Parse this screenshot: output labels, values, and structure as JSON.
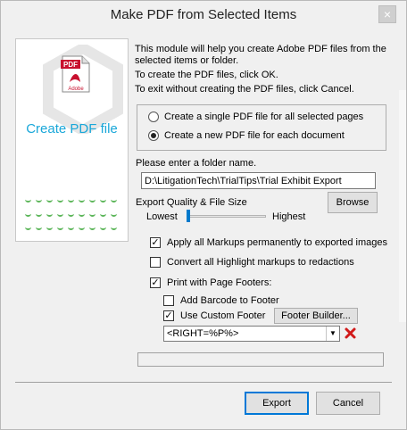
{
  "window": {
    "title": "Make PDF from Selected Items",
    "close_glyph": "×"
  },
  "banner": {
    "icon": "adobe-pdf-file-icon",
    "icon_badge": "PDF",
    "icon_brand": "Adobe",
    "title": "Create PDF file"
  },
  "intro": {
    "line1": "This module will help you create Adobe PDF files from the selected items or folder.",
    "line2": "To create the PDF files, click OK.",
    "line3": "To exit without creating the PDF files, click Cancel."
  },
  "mode": {
    "options": [
      {
        "label": "Create a single PDF file for all selected pages",
        "selected": false
      },
      {
        "label": "Create a new PDF file for each document",
        "selected": true
      }
    ]
  },
  "folder": {
    "label": "Please enter a folder name.",
    "value": "D:\\LitigationTech\\TrialTips\\Trial Exhibit Export",
    "browse_label": "Browse"
  },
  "quality": {
    "label": "Export Quality & File Size",
    "min_label": "Lowest",
    "max_label": "Highest",
    "level_fraction": 0.0
  },
  "options": {
    "apply_markups": {
      "label": "Apply all Markups permanently to exported images",
      "checked": true
    },
    "convert_highlight": {
      "label": "Convert all Highlight markups to redactions",
      "checked": false
    },
    "page_footers": {
      "label": "Print with Page Footers:",
      "checked": true
    },
    "add_barcode": {
      "label": "Add Barcode to Footer",
      "checked": false
    },
    "custom_footer": {
      "label": "Use Custom Footer",
      "checked": true
    },
    "footer_builder_label": "Footer Builder...",
    "footer_value": "<RIGHT=%P%>",
    "check_glyph": "✓",
    "dropdown_glyph": "▼",
    "delete_glyph": "✖"
  },
  "footer_buttons": {
    "export_label": "Export",
    "cancel_label": "Cancel"
  },
  "colors": {
    "accent_blue": "#19a7d9",
    "delete_red": "#d11a1a",
    "slider_blue": "#007acc",
    "dot_green": "#5db65a"
  }
}
